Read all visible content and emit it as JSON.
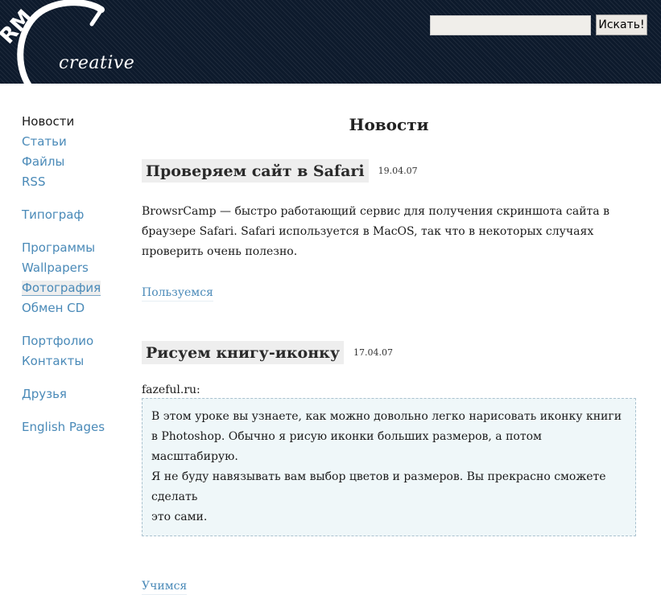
{
  "header": {
    "logo_text": "creative",
    "logo_mark": "RM",
    "search": {
      "placeholder": "",
      "value": "",
      "button_label": "Искать!"
    }
  },
  "sidebar": {
    "groups": [
      [
        {
          "label": "Новости",
          "current": true
        },
        {
          "label": "Статьи"
        },
        {
          "label": "Файлы"
        },
        {
          "label": "RSS"
        }
      ],
      [
        {
          "label": "Типограф"
        }
      ],
      [
        {
          "label": "Программы"
        },
        {
          "label": "Wallpapers"
        },
        {
          "label": "Фотография"
        },
        {
          "label": "Обмен CD"
        }
      ],
      [
        {
          "label": "Портфолио"
        },
        {
          "label": "Контакты"
        }
      ],
      [
        {
          "label": "Друзья"
        }
      ],
      [
        {
          "label": "English Pages"
        }
      ]
    ]
  },
  "main": {
    "title": "Новости",
    "posts": [
      {
        "title": "Проверяем сайт в Safari",
        "date": "19.04.07",
        "body": "BrowsrCamp — быстро работающий сервис для получения скриншота сайта в браузере Safari. Safari используется в MacOS, так что в некоторых случаях проверить очень полезно.",
        "link": "Пользуемся"
      },
      {
        "title": "Рисуем книгу-иконку",
        "date": "17.04.07",
        "quote_source": "fazeful.ru:",
        "quote_lines": [
          "В этом уроке вы узнаете, как можно довольно легко нарисовать иконку книги",
          "в Photoshop. Обычно я рисую иконки больших размеров, а потом масштабирую.",
          "Я не буду навязывать вам выбор цветов и размеров. Вы прекрасно сможете сделать",
          "это сами."
        ],
        "link": "Учимся"
      }
    ]
  },
  "colors": {
    "header_bg": "#0d1a2c",
    "link": "#4a8ab8",
    "title_bg": "#eeeeee",
    "quote_bg": "#eff7f9"
  }
}
